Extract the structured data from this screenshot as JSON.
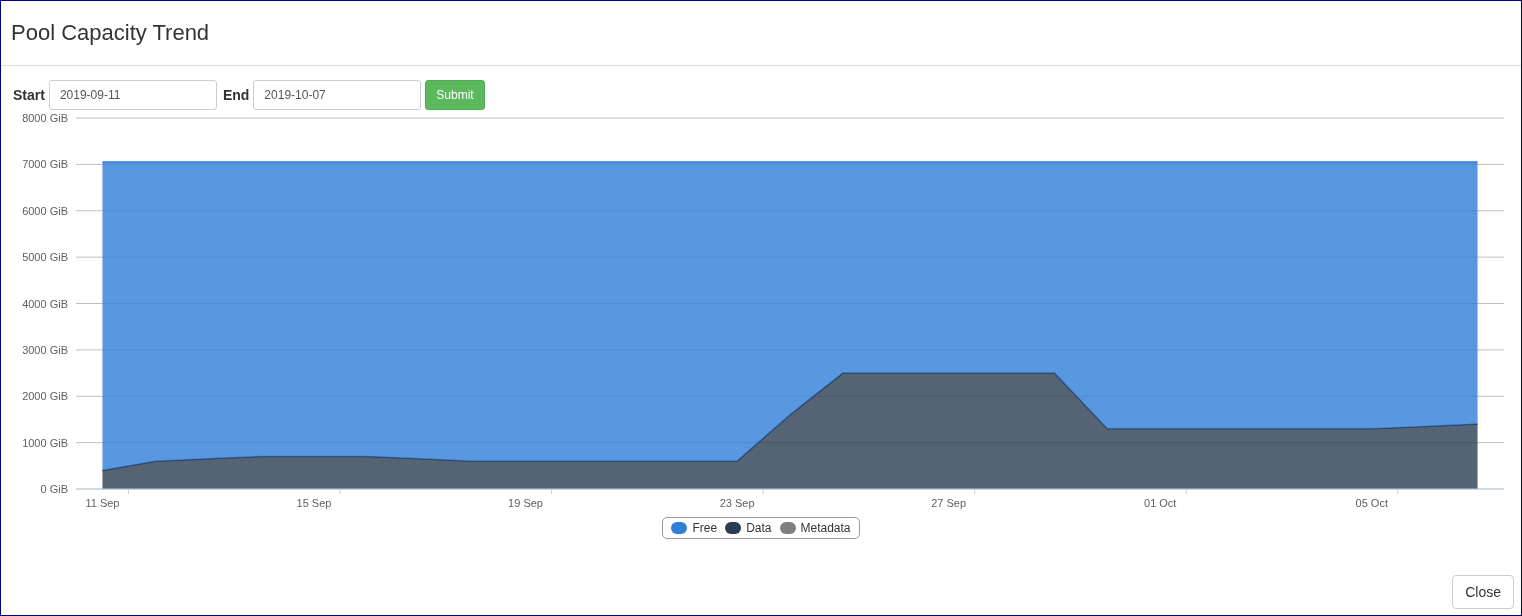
{
  "window": {
    "title": "Pool Capacity Trend"
  },
  "form": {
    "fields": [
      {
        "label": "Start",
        "value": "2019-09-11"
      },
      {
        "label": "End",
        "value": "2019-10-07"
      }
    ],
    "submit": "Submit"
  },
  "chart_data": {
    "type": "area",
    "stacked": true,
    "categories": [
      "11 Sep",
      null,
      null,
      null,
      "15 Sep",
      null,
      null,
      null,
      "19 Sep",
      null,
      null,
      null,
      "23 Sep",
      null,
      null,
      null,
      "27 Sep",
      null,
      null,
      null,
      "01 Oct",
      null,
      null,
      null,
      "05 Oct",
      null,
      null
    ],
    "series": [
      {
        "name": "Free",
        "color": "#2f7ed8",
        "values": [
          6650,
          6450,
          6400,
          6350,
          6350,
          6350,
          6400,
          6450,
          6450,
          6450,
          6450,
          6450,
          6450,
          5450,
          4550,
          4550,
          4550,
          4550,
          4550,
          5750,
          5750,
          5750,
          5750,
          5750,
          5750,
          5700,
          5650
        ]
      },
      {
        "name": "Data",
        "color": "#2a3d52",
        "values": [
          400,
          600,
          650,
          700,
          700,
          700,
          650,
          600,
          600,
          600,
          600,
          600,
          600,
          1600,
          2500,
          2500,
          2500,
          2500,
          2500,
          1300,
          1300,
          1300,
          1300,
          1300,
          1300,
          1350,
          1400
        ]
      },
      {
        "name": "Metadata",
        "color": "#808080",
        "values": [
          null,
          null,
          null,
          null,
          null,
          null,
          null,
          null,
          null,
          null,
          null,
          null,
          null,
          null,
          null,
          null,
          null,
          null,
          null,
          null,
          null,
          null,
          null,
          null,
          null,
          null,
          null
        ]
      }
    ],
    "grid": true,
    "ylim": [
      0,
      8000
    ],
    "yticks": [
      {
        "value": 0,
        "label": "0 GiB"
      },
      {
        "value": 1000,
        "label": "1000 GiB"
      },
      {
        "value": 2000,
        "label": "2000 GiB"
      },
      {
        "value": 3000,
        "label": "3000 GiB"
      },
      {
        "value": 4000,
        "label": "4000 GiB"
      },
      {
        "value": 5000,
        "label": "5000 GiB"
      },
      {
        "value": 6000,
        "label": "6000 GiB"
      },
      {
        "value": 7000,
        "label": "7000 GiB"
      },
      {
        "value": 8000,
        "label": "8000 GiB"
      }
    ]
  },
  "footer": {
    "close": "Close"
  }
}
